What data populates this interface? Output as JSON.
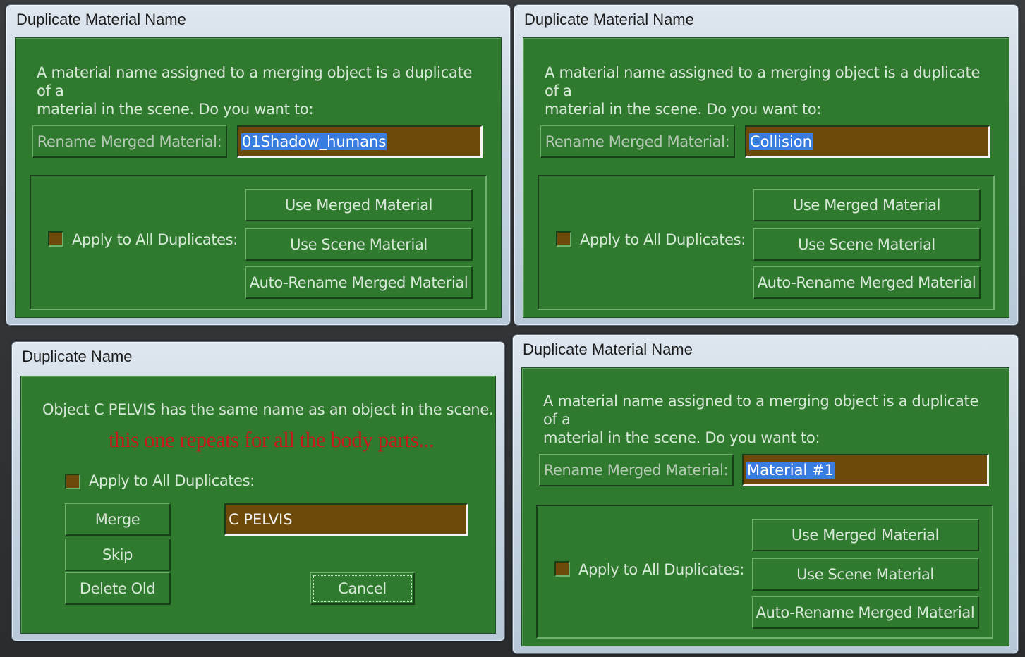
{
  "dialog_tl": {
    "title": "Duplicate Material Name",
    "message_line1": "A material name assigned to a merging object is a duplicate of a",
    "message_line2": "material in the scene. Do you want to:",
    "rename_label": "Rename Merged Material:",
    "rename_value": "01Shadow_humans",
    "apply_all_label": "Apply to All Duplicates:",
    "use_merged": "Use Merged Material",
    "use_scene": "Use Scene Material",
    "auto_rename": "Auto-Rename Merged Material"
  },
  "dialog_tr": {
    "title": "Duplicate Material Name",
    "message_line1": "A material name assigned to a merging object is a duplicate of a",
    "message_line2": "material in the scene. Do you want to:",
    "rename_label": "Rename Merged Material:",
    "rename_value": "Collision",
    "apply_all_label": "Apply to All Duplicates:",
    "use_merged": "Use Merged Material",
    "use_scene": "Use Scene Material",
    "auto_rename": "Auto-Rename Merged Material"
  },
  "dialog_bl": {
    "title": "Duplicate Name",
    "message": "Object C PELVIS has the same name as an object in the scene.",
    "annotation": "this one repeats for all the body parts...",
    "apply_all_label": "Apply to All Duplicates:",
    "merge": "Merge",
    "skip": "Skip",
    "delete_old": "Delete Old",
    "name_value": "C PELVIS",
    "cancel": "Cancel"
  },
  "dialog_br": {
    "title": "Duplicate Material Name",
    "message_line1": "A material name assigned to a merging object is a duplicate of a",
    "message_line2": "material in the scene. Do you want to:",
    "rename_label": "Rename Merged Material:",
    "rename_value": "Material #1",
    "apply_all_label": "Apply to All Duplicates:",
    "use_merged": "Use Merged Material",
    "use_scene": "Use Scene Material",
    "auto_rename": "Auto-Rename Merged Material"
  },
  "colors": {
    "panel_green": "#2f7a2f",
    "field_brown": "#6e4a0a",
    "selection_blue": "#3a7de0",
    "annotation_red": "#c41a1a"
  }
}
